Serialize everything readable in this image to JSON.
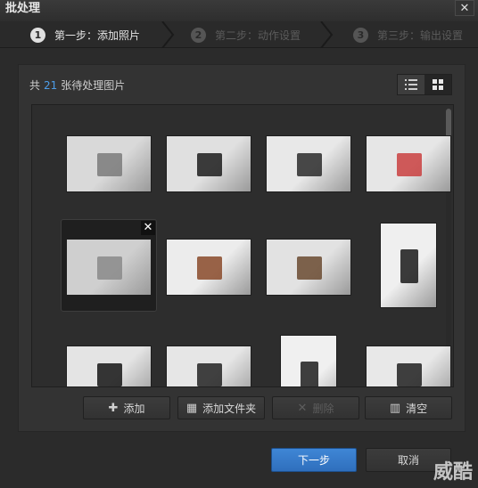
{
  "window": {
    "title": "批处理",
    "close_glyph": "✕"
  },
  "steps": [
    {
      "num": "1",
      "label": "第一步：添加照片",
      "active": true
    },
    {
      "num": "2",
      "label": "第二步：动作设置",
      "active": false
    },
    {
      "num": "3",
      "label": "第三步：输出设置",
      "active": false
    }
  ],
  "panel": {
    "count_prefix": "共",
    "count_value": "21",
    "count_suffix": "张待处理图片",
    "view_modes": [
      "list-view-icon",
      "grid-view-icon"
    ],
    "active_view": "grid-view-icon"
  },
  "thumbnails": [
    {
      "name": "white-box-photo",
      "colors": [
        "#d9d9d9",
        "#7a7a7a"
      ],
      "selected": false
    },
    {
      "name": "gadgets-flatlay-photo",
      "colors": [
        "#e0e0e0",
        "#1c1c1c"
      ],
      "selected": false
    },
    {
      "name": "book-device-photo",
      "colors": [
        "#e8e8e8",
        "#2a2a2a"
      ],
      "selected": false
    },
    {
      "name": "colorful-icons-photo",
      "colors": [
        "#e6e6e6",
        "#c94040"
      ],
      "selected": false
    },
    {
      "name": "card-on-page-photo",
      "colors": [
        "#cfcfcf",
        "#8a8a8a"
      ],
      "selected": true
    },
    {
      "name": "headphones-page-photo",
      "colors": [
        "#ececec",
        "#8a4a2a"
      ],
      "selected": false
    },
    {
      "name": "headphones-closeup-photo",
      "colors": [
        "#e2e2e2",
        "#6a4a30"
      ],
      "selected": false
    },
    {
      "name": "headphones-standing-photo",
      "colors": [
        "#efefef",
        "#1a1a1a"
      ],
      "selected": false
    },
    {
      "name": "gamepad-photo",
      "colors": [
        "#e4e4e4",
        "#151515"
      ],
      "selected": false
    },
    {
      "name": "black-device-book-photo",
      "colors": [
        "#e6e6e6",
        "#222"
      ],
      "selected": false
    },
    {
      "name": "phone-page-photo",
      "colors": [
        "#f0f0f0",
        "#1e1e1e"
      ],
      "selected": false
    },
    {
      "name": "tablet-page-photo",
      "colors": [
        "#e8e8e8",
        "#202020"
      ],
      "selected": false
    }
  ],
  "delete_glyph": "✕",
  "actions": {
    "add": {
      "label": "添加",
      "icon": "plus-icon",
      "glyph": "✚"
    },
    "add_folder": {
      "label": "添加文件夹",
      "icon": "folder-add-icon",
      "glyph": "▦"
    },
    "delete": {
      "label": "删除",
      "icon": "delete-icon",
      "glyph": "✕"
    },
    "clear": {
      "label": "清空",
      "icon": "trash-icon",
      "glyph": "▥"
    }
  },
  "footer": {
    "next_label": "下一步",
    "cancel_label": "取消"
  },
  "watermark": "威酷",
  "colors": {
    "accent": "#3f86d6",
    "count": "#4d9de8",
    "bg": "#2b2b2b"
  }
}
